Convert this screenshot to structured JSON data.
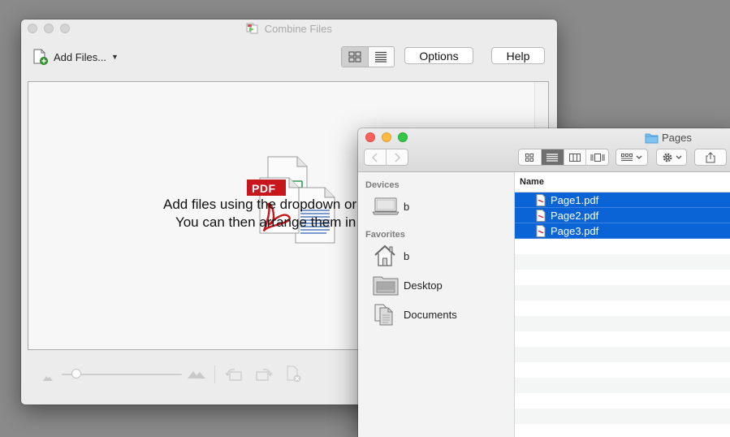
{
  "combine_window": {
    "title": "Combine Files",
    "toolbar": {
      "add_files_label": "Add Files...",
      "options_label": "Options",
      "help_label": "Help"
    },
    "icon_labels": {
      "pdf": "PDF"
    },
    "drop_text_line1": "Add files using the dropdown or drag and",
    "drop_text_line2": "You can then arrange them in the ord"
  },
  "finder_window": {
    "title": "Pages",
    "sidebar": {
      "devices_header": "Devices",
      "devices": [
        {
          "label": "b",
          "icon": "laptop-icon"
        }
      ],
      "favorites_header": "Favorites",
      "favorites": [
        {
          "label": "b",
          "icon": "home-icon"
        },
        {
          "label": "Desktop",
          "icon": "desktop-folder-icon"
        },
        {
          "label": "Documents",
          "icon": "documents-folder-icon"
        }
      ]
    },
    "list": {
      "name_header": "Name",
      "files": [
        {
          "name": "Page1.pdf",
          "selected": true
        },
        {
          "name": "Page2.pdf",
          "selected": true
        },
        {
          "name": "Page3.pdf",
          "selected": true
        }
      ]
    }
  },
  "colors": {
    "selection": "#0b64d6",
    "close": "#fc605c",
    "minimize": "#fdbc40",
    "zoom": "#34c84a",
    "pdf_red": "#c8161d"
  }
}
